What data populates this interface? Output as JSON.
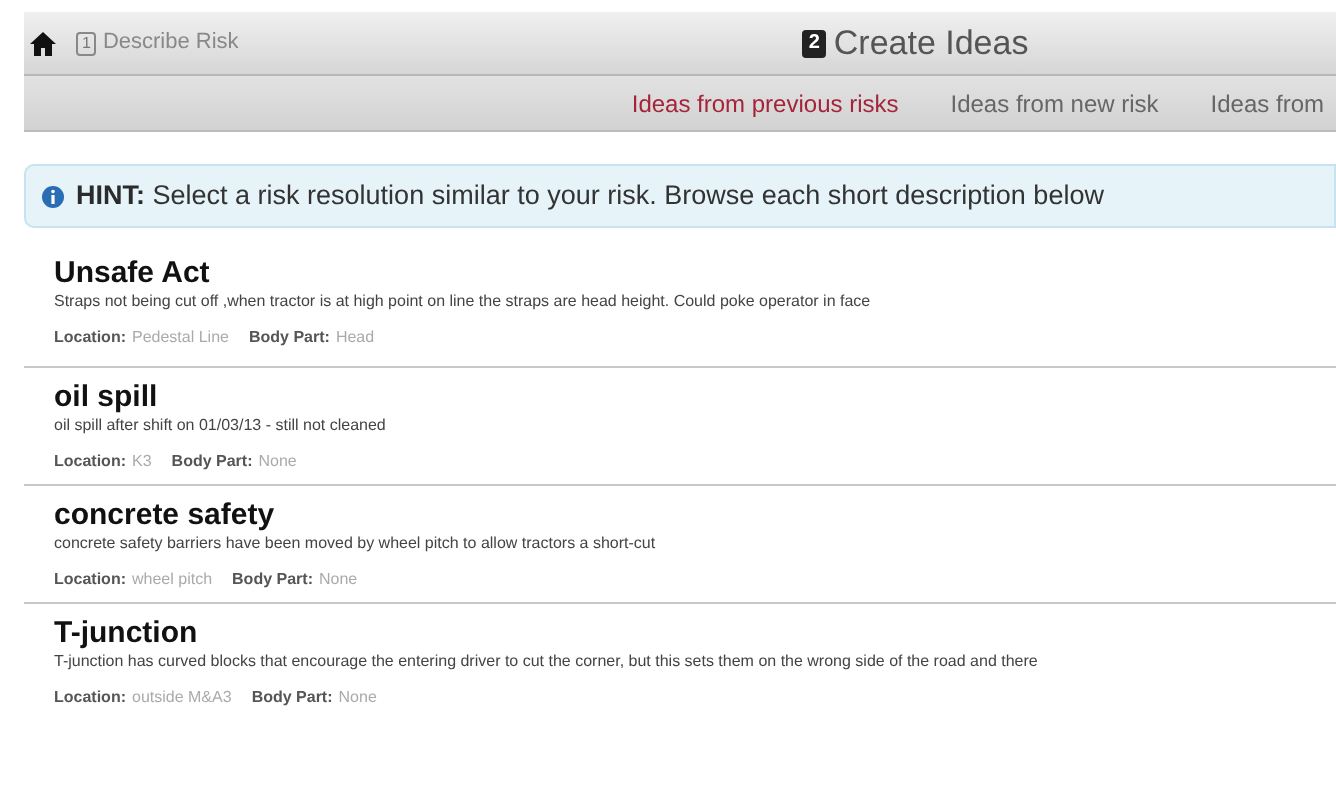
{
  "header": {
    "step_1": {
      "number": "1",
      "label": "Describe Risk"
    },
    "step_2": {
      "number": "2",
      "label": "Create Ideas"
    }
  },
  "tabs": [
    {
      "label": "Ideas from previous risks",
      "selected": true
    },
    {
      "label": "Ideas from new risk",
      "selected": false
    },
    {
      "label": "Ideas from",
      "selected": false
    }
  ],
  "hint": {
    "label": "HINT:",
    "text": "Select a risk resolution similar to your risk. Browse each short description below"
  },
  "risks": [
    {
      "title": "Unsafe Act",
      "description": "Straps not being cut off ,when tractor is at high point on line the straps are head height. Could poke operator in face",
      "location_label": "Location:",
      "location": "Pedestal Line",
      "body_part_label": "Body Part:",
      "body_part": "Head"
    },
    {
      "title": "oil spill",
      "description": "oil spill after shift on 01/03/13 - still not cleaned",
      "location_label": "Location:",
      "location": "K3",
      "body_part_label": "Body Part:",
      "body_part": "None"
    },
    {
      "title": "concrete safety",
      "description": "concrete safety barriers have been moved by wheel pitch to allow tractors a short-cut",
      "location_label": "Location:",
      "location": "wheel pitch",
      "body_part_label": "Body Part:",
      "body_part": "None"
    },
    {
      "title": "T-junction",
      "description": "T-junction has curved blocks that encourage the entering driver to cut the corner, but this sets them on the wrong side of the road and there",
      "location_label": "Location:",
      "location": "outside M&A3",
      "body_part_label": "Body Part:",
      "body_part": "None"
    }
  ]
}
